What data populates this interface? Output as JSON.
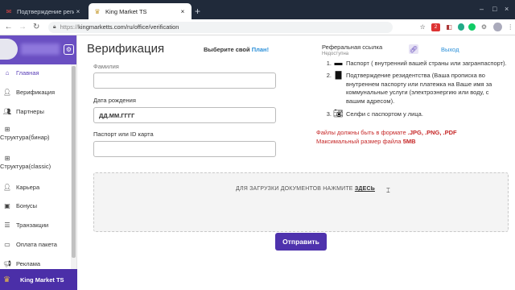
{
  "browser": {
    "tabs": [
      {
        "title": "Подтверждение регистрации"
      },
      {
        "title": "King Market TS"
      }
    ],
    "new_tab": "+",
    "window_controls": [
      "–",
      "□",
      "×"
    ],
    "url_scheme": "https://",
    "url_rest": "kingmarketts.com/ru/office/verification",
    "ext_badge": "2"
  },
  "sidebar": {
    "items": [
      {
        "label": "Главная",
        "icon": "home-icon"
      },
      {
        "label": "Верификация",
        "icon": "user-check-icon"
      },
      {
        "label": "Партнеры",
        "icon": "users-icon"
      },
      {
        "label": "Структура(бинар)",
        "icon": "sitemap-icon"
      },
      {
        "label": "Структура(classic)",
        "icon": "sitemap-icon"
      },
      {
        "label": "Карьера",
        "icon": "user-tie-icon"
      },
      {
        "label": "Бонусы",
        "icon": "gift-icon"
      },
      {
        "label": "Транзакции",
        "icon": "list-icon"
      },
      {
        "label": "Оплата пакета",
        "icon": "card-icon"
      },
      {
        "label": "Реклама",
        "icon": "megaphone-icon"
      }
    ],
    "footer_brand": "King Market TS"
  },
  "header": {
    "title": "Верификация",
    "choose_plan_prefix": "Выберите свой",
    "choose_plan_link": "План!",
    "ref_label": "Реферальная ссылка",
    "ref_sub": "Недоступна",
    "logout": "Выход"
  },
  "form": {
    "field1_label": "Фамилия",
    "birth_label": "Дата рождения",
    "birth_placeholder": "ДД.ММ.ГГГГ",
    "passport_label": "Паспорт или ID карта"
  },
  "docs": {
    "items": [
      {
        "num": "1.",
        "text": "Паспорт ( внутренний вашей страны или загранпаспорт)."
      },
      {
        "num": "2.",
        "text": "Подтверждение резидентства (Ваша прописка во внутреннем паспорту или платежка на Ваше имя за коммунальные услуги (электроэнергию или воду, с вашим адресом)."
      },
      {
        "num": "3.",
        "text": "Селфи с паспортом у лица."
      }
    ],
    "formats_prefix": "Файлы должны быть в формате",
    "formats": ".JPG, .PNG, .PDF",
    "max_size_prefix": "Максимальный размер файла",
    "max_size": "5MB"
  },
  "upload": {
    "text": "ДЛЯ ЗАГРУЗКИ ДОКУМЕНТОВ НАЖМИТЕ",
    "link": "ЗДЕСЬ"
  },
  "submit_label": "Отправить"
}
